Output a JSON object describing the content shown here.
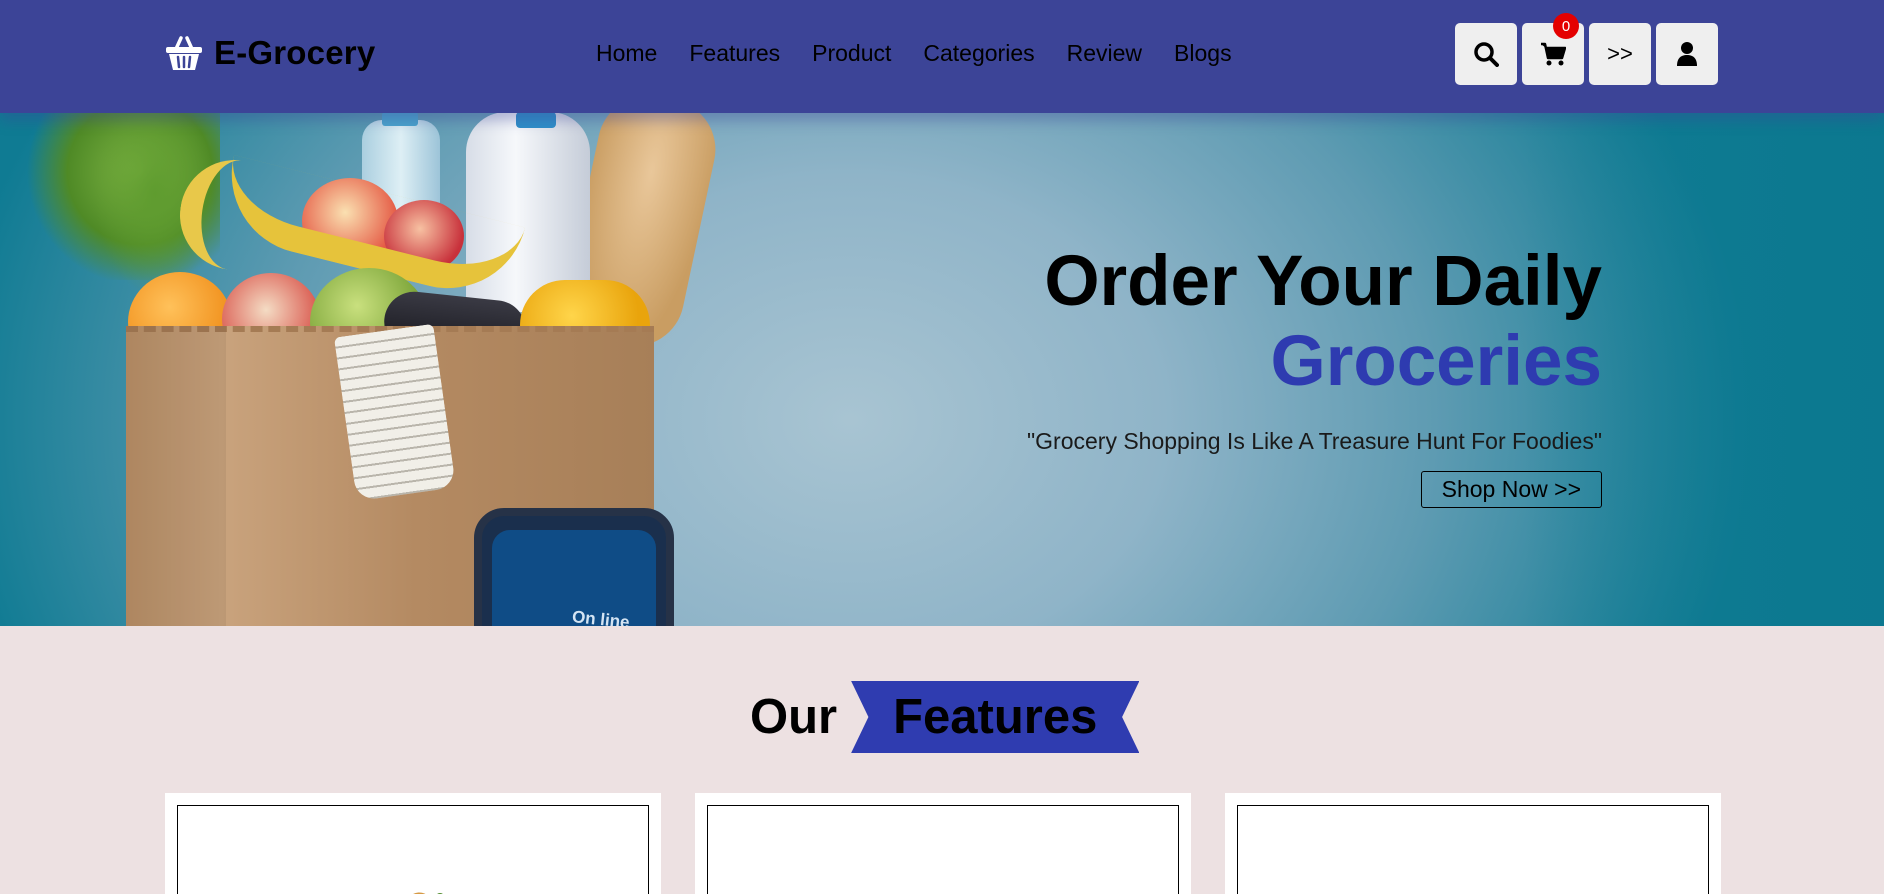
{
  "app": {
    "brand": "E-Grocery"
  },
  "nav": {
    "items": [
      "Home",
      "Features",
      "Product",
      "Categories",
      "Review",
      "Blogs"
    ]
  },
  "toolbar": {
    "cart_count": "0",
    "menu_label": ">>",
    "icons": [
      "search-icon",
      "cart-icon",
      "user-icon"
    ]
  },
  "hero": {
    "title_line1": "Order Your Daily",
    "title_line2": "Groceries",
    "quote": "\"Grocery Shopping Is Like A Treasure Hunt For Foodies\"",
    "cta": "Shop Now >>",
    "phone_text": "On line"
  },
  "features": {
    "heading_our": "Our",
    "heading_features": "Features"
  },
  "colors": {
    "header_bg": "#3c4497",
    "accent": "#2e3bb0",
    "page_bg": "#ede1e2",
    "badge": "#e40000"
  }
}
